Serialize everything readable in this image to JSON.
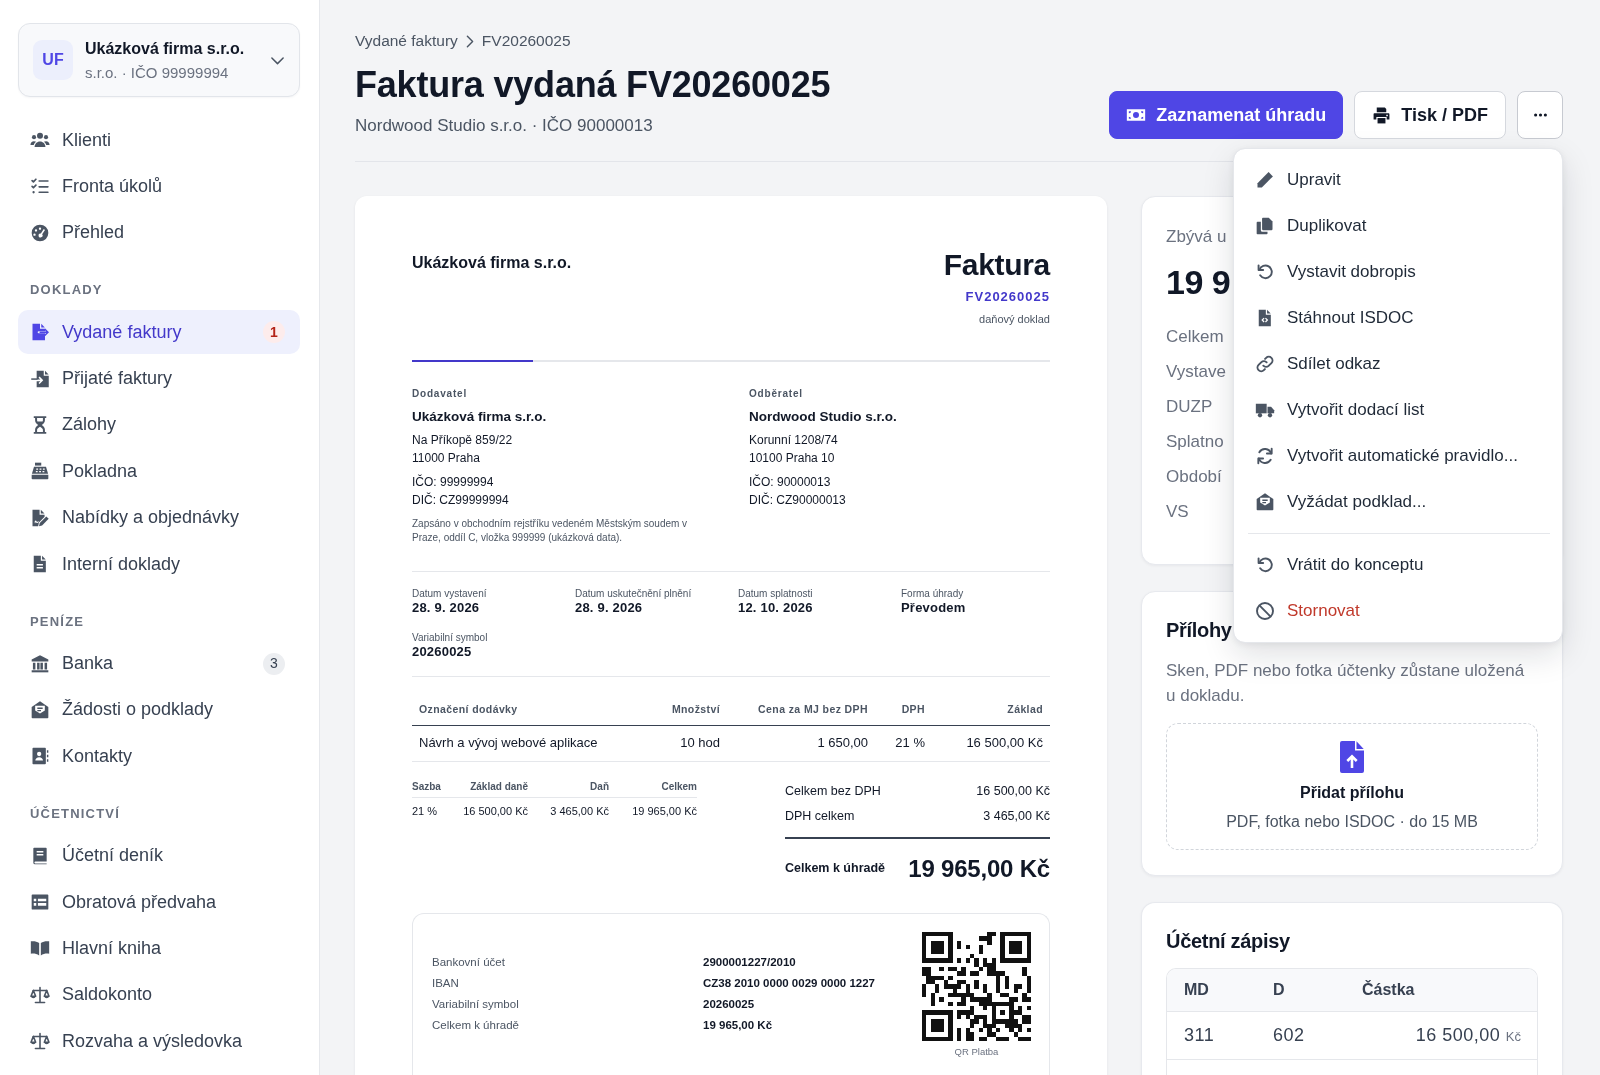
{
  "sidebar": {
    "workspace": {
      "initials": "UF",
      "name": "Ukázková firma s.r.o.",
      "detail": "s.r.o. · IČO 99999994"
    },
    "sections": [
      {
        "items": [
          {
            "label": "Klienti",
            "selected": false
          },
          {
            "label": "Fronta úkolů",
            "selected": false
          },
          {
            "label": "Přehled",
            "selected": false
          }
        ]
      },
      {
        "heading": "DOKLADY",
        "items": [
          {
            "label": "Vydané faktury",
            "selected": true,
            "badge": {
              "text": "1",
              "kind": "alert"
            }
          },
          {
            "label": "Přijaté faktury",
            "selected": false
          },
          {
            "label": "Zálohy",
            "selected": false
          },
          {
            "label": "Pokladna",
            "selected": false
          },
          {
            "label": "Nabídky a objednávky",
            "selected": false
          },
          {
            "label": "Interní doklady",
            "selected": false
          }
        ]
      },
      {
        "heading": "PENÍZE",
        "items": [
          {
            "label": "Banka",
            "selected": false,
            "badge": {
              "text": "3",
              "kind": "count"
            }
          },
          {
            "label": "Žádosti o podklady",
            "selected": false
          },
          {
            "label": "Kontakty",
            "selected": false
          }
        ]
      },
      {
        "heading": "ÚČETNICTVÍ",
        "items": [
          {
            "label": "Účetní deník",
            "selected": false
          },
          {
            "label": "Obratová předvaha",
            "selected": false
          },
          {
            "label": "Hlavní kniha",
            "selected": false
          },
          {
            "label": "Saldokonto",
            "selected": false
          },
          {
            "label": "Rozvaha a výsledovka",
            "selected": false
          }
        ]
      }
    ]
  },
  "header": {
    "breadcrumb": [
      {
        "label": "Vydané faktury"
      },
      {
        "label": "FV20260025"
      }
    ],
    "title": "Faktura vydaná FV20260025",
    "subtitle": "Nordwood Studio s.r.o. · IČO 90000013",
    "actions": [
      {
        "label": "Zaznamenat úhradu",
        "kind": "primary"
      },
      {
        "label": "Tisk / PDF",
        "kind": "secondary"
      },
      {
        "kind": "more",
        "expanded": true
      }
    ]
  },
  "menu": {
    "groups": [
      {
        "items": [
          {
            "label": "Upravit",
            "kind": "default"
          },
          {
            "label": "Duplikovat",
            "kind": "default"
          },
          {
            "label": "Vystavit dobropis",
            "kind": "default"
          },
          {
            "label": "Stáhnout ISDOC",
            "kind": "default"
          },
          {
            "label": "Sdílet odkaz",
            "kind": "default"
          },
          {
            "label": "Vytvořit dodací list",
            "kind": "default"
          },
          {
            "label": "Vytvořit automatické pravidlo...",
            "kind": "default"
          },
          {
            "label": "Vyžádat podklad...",
            "kind": "default"
          }
        ]
      },
      {
        "items": [
          {
            "label": "Vrátit do konceptu",
            "kind": "default"
          },
          {
            "label": "Stornovat",
            "kind": "danger"
          }
        ]
      }
    ]
  },
  "invoice": {
    "issuer": "Ukázková firma s.r.o.",
    "doc_title": "Faktura",
    "number": "FV20260025",
    "doc_type": "daňový doklad",
    "parties": [
      {
        "label": "Dodavatel",
        "name": "Ukázková firma s.r.o.",
        "address": [
          "Na Příkopě 859/22",
          "11000 Praha"
        ],
        "ids": [
          "IČO: 99999994",
          "DIČ: CZ99999994"
        ],
        "note": "Zapsáno v obchodním rejstříku vedeném Městským soudem v Praze, oddíl C, vložka 999999 (ukázková data)."
      },
      {
        "label": "Odběratel",
        "name": "Nordwood Studio s.r.o.",
        "address": [
          "Korunní 1208/74",
          "10100 Praha 10"
        ],
        "ids": [
          "IČO: 90000013",
          "DIČ: CZ90000013"
        ]
      }
    ],
    "dates": [
      {
        "label": "Datum vystavení",
        "value": "28. 9. 2026"
      },
      {
        "label": "Datum uskutečnění plnění",
        "value": "28. 9. 2026"
      },
      {
        "label": "Datum splatnosti",
        "value": "12. 10. 2026"
      },
      {
        "label": "Forma úhrady",
        "value": "Převodem"
      }
    ],
    "variable_symbol": {
      "label": "Variabilní symbol",
      "value": "20260025"
    },
    "items_table": {
      "columns": [
        "Označení dodávky",
        "Množství",
        "Cena za MJ bez DPH",
        "DPH",
        "Základ"
      ],
      "rows": [
        [
          "Návrh a vývoj webové aplikace",
          "10 hod",
          "1 650,00",
          "21 %",
          "16 500,00 Kč"
        ]
      ]
    },
    "vat_table": {
      "columns": [
        "Sazba",
        "Základ daně",
        "Daň",
        "Celkem"
      ],
      "rows": [
        [
          "21 %",
          "16 500,00 Kč",
          "3 465,00 Kč",
          "19 965,00 Kč"
        ]
      ]
    },
    "totals": [
      {
        "label": "Celkem bez DPH",
        "value": "16 500,00 Kč"
      },
      {
        "label": "DPH celkem",
        "value": "3 465,00 Kč"
      }
    ],
    "grand_total": {
      "label": "Celkem k úhradě",
      "value": "19 965,00 Kč"
    },
    "payment": {
      "rows": [
        {
          "label": "Bankovní účet",
          "value": "2900001227/2010"
        },
        {
          "label": "IBAN",
          "value": "CZ38 2010 0000 0029 0000 1227"
        },
        {
          "label": "Variabilní symbol",
          "value": "20260025"
        },
        {
          "label": "Celkem k úhradě",
          "value": "19 965,00 Kč"
        }
      ],
      "qr_caption": "QR Platba"
    }
  },
  "summary": {
    "heading": "Zbývá u",
    "amount": "19 9",
    "labels": [
      "Celkem",
      "Vystave",
      "DUZP",
      "Splatno",
      "Období",
      "VS"
    ]
  },
  "attachments": {
    "title": "Přílohy",
    "description": "Sken, PDF nebo fotka účtenky zůstane uložená u dokladu.",
    "dropzone": {
      "title": "Přidat přílohu",
      "hint": "PDF, fotka nebo ISDOC · do 15 MB"
    }
  },
  "journal": {
    "title": "Účetní zápisy",
    "columns": [
      "MD",
      "D",
      "Částka"
    ],
    "rows": [
      {
        "md": "311",
        "d": "602",
        "amount": "16 500,00",
        "currency": "Kč"
      }
    ]
  }
}
